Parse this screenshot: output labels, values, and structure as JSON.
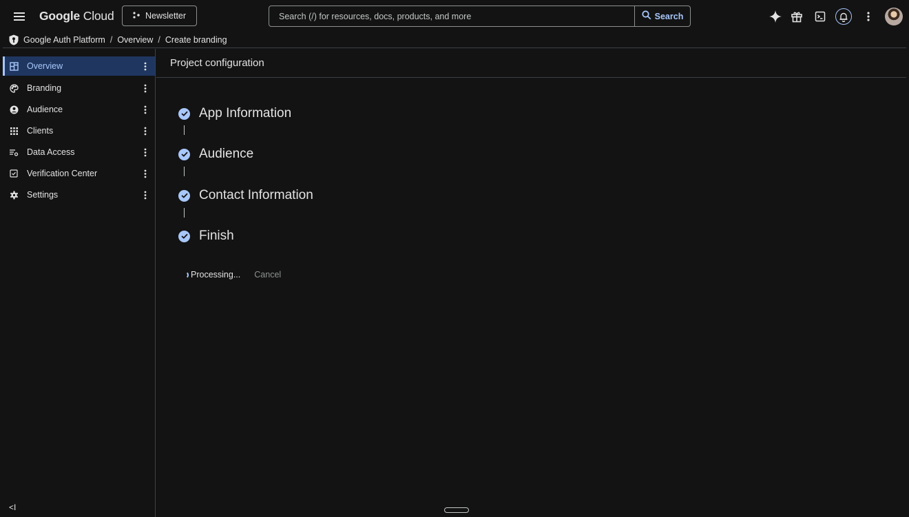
{
  "topbar": {
    "logo_google": "Google",
    "logo_cloud": "Cloud",
    "newsletter_label": "Newsletter",
    "search_placeholder": "Search (/) for resources, docs, products, and more",
    "search_button_label": "Search"
  },
  "breadcrumb": {
    "items": [
      "Google Auth Platform",
      "Overview",
      "Create branding"
    ],
    "separator": "/"
  },
  "sidebar": {
    "items": [
      {
        "label": "Overview",
        "icon": "dashboard-icon",
        "active": true
      },
      {
        "label": "Branding",
        "icon": "palette-icon",
        "active": false
      },
      {
        "label": "Audience",
        "icon": "account-circle-icon",
        "active": false
      },
      {
        "label": "Clients",
        "icon": "apps-grid-icon",
        "active": false
      },
      {
        "label": "Data Access",
        "icon": "data-access-icon",
        "active": false
      },
      {
        "label": "Verification Center",
        "icon": "verification-icon",
        "active": false
      },
      {
        "label": "Settings",
        "icon": "gear-icon",
        "active": false
      }
    ],
    "collapse_label": "<I"
  },
  "main": {
    "title": "Project configuration",
    "steps": [
      {
        "label": "App Information",
        "status": "complete"
      },
      {
        "label": "Audience",
        "status": "complete"
      },
      {
        "label": "Contact Information",
        "status": "complete"
      },
      {
        "label": "Finish",
        "status": "complete"
      }
    ],
    "processing_label": "Processing...",
    "cancel_label": "Cancel"
  },
  "colors": {
    "background": "#131314",
    "accent": "#a8c7fa",
    "active_nav_bg": "#1f3760",
    "border": "#3c4043"
  }
}
